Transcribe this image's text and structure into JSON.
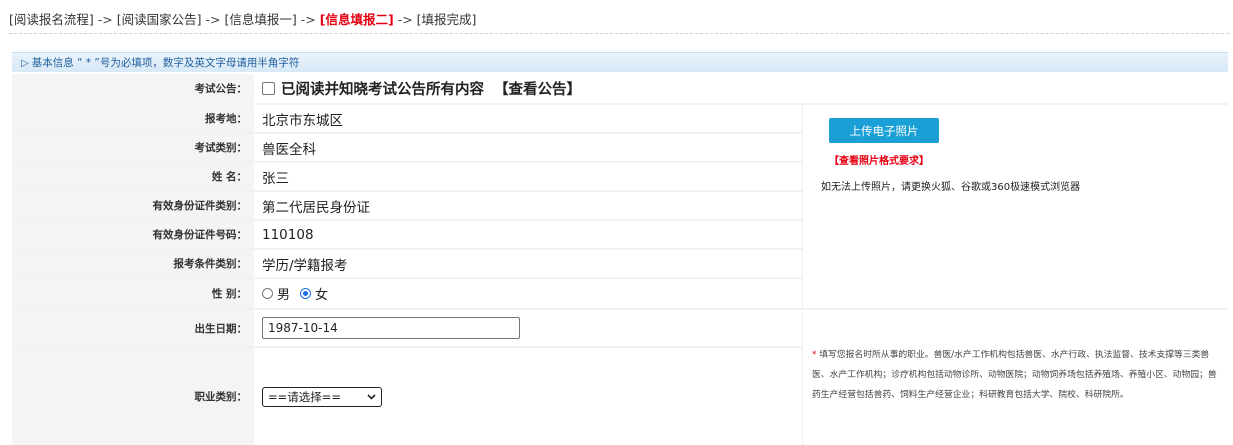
{
  "breadcrumb": {
    "items": [
      "[阅读报名流程]",
      "[阅读国家公告]",
      "[信息填报一]",
      "[信息填报二]",
      "[填报完成]"
    ],
    "arrow": "->"
  },
  "section": {
    "title": "基本信息 “ * ”号为必填项，数字及英文字母请用半角字符"
  },
  "fields": {
    "notice_label": "考试公告：",
    "notice_checkbox_text": "已阅读并知晓考试公告所有内容",
    "notice_link": "【查看公告】",
    "location_label": "报考地：",
    "location_value": "北京市东城区",
    "category_label": "考试类别：",
    "category_value": "兽医全科",
    "name_label": "姓 名：",
    "name_value": "张三",
    "idtype_label": "有效身份证件类别：",
    "idtype_value": "第二代居民身份证",
    "idnum_label": "有效身份证件号码：",
    "idnum_value": "110108",
    "condition_label": "报考条件类别：",
    "condition_value": "学历/学籍报考",
    "gender_label": "性 别：",
    "gender_male": "男",
    "gender_female": "女",
    "gender_selected": "女",
    "birth_label": "出生日期：",
    "birth_value": "1987-10-14",
    "job_label": "职业类别：",
    "job_select": "==请选择=="
  },
  "photo": {
    "upload_button": "上传电子照片",
    "format_link": "【查看照片格式要求】",
    "note": "如无法上传照片，请更换火狐、谷歌或360极速模式浏览器"
  },
  "job_note": {
    "star": "*",
    "text": "填写您报名时所从事的职业。兽医/水产工作机构包括兽医、水产行政、执法监督、技术支撑等三类兽医、水产工作机构；诊疗机构包括动物诊所、动物医院；动物饲养场包括养殖场、养殖小区、动物园；兽药生产经营包括兽药、饲料生产经营企业；科研教育包括大学、院校、科研院所。"
  },
  "colors": {
    "accent_red": "#e60012",
    "button_blue": "#1a9fd6",
    "header_text": "#1c5d9b",
    "radio_blue": "#1a73e8"
  },
  "icons": {
    "section": "triangle-right-icon",
    "select": "chevron-down-icon"
  }
}
